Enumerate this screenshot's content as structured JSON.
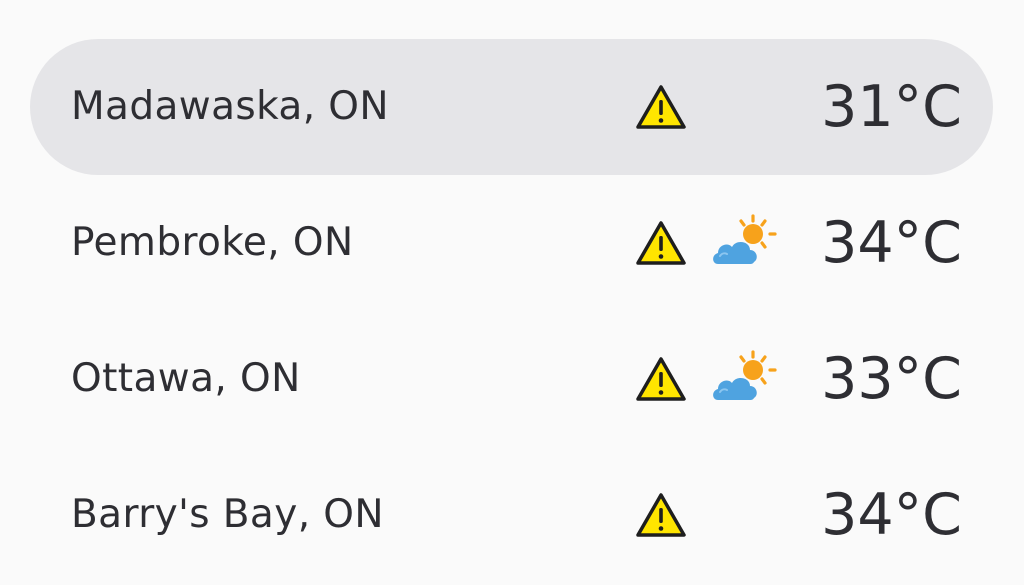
{
  "locations": [
    {
      "city": "Madawaska, ON",
      "temperature": "31°C",
      "alert": "warning-icon",
      "condition": null,
      "selected": true
    },
    {
      "city": "Pembroke, ON",
      "temperature": "34°C",
      "alert": "warning-icon",
      "condition": "partly-sunny-icon",
      "selected": false
    },
    {
      "city": "Ottawa, ON",
      "temperature": "33°C",
      "alert": "warning-icon",
      "condition": "partly-sunny-icon",
      "selected": false
    },
    {
      "city": "Barry's Bay, ON",
      "temperature": "34°C",
      "alert": "warning-icon",
      "condition": null,
      "selected": false
    }
  ],
  "colors": {
    "selected_row_bg": "#e5e5e8",
    "text": "#2e2e33",
    "warning_fill": "#ffe500",
    "sun": "#f7a21b",
    "cloud": "#4fa3e0"
  }
}
